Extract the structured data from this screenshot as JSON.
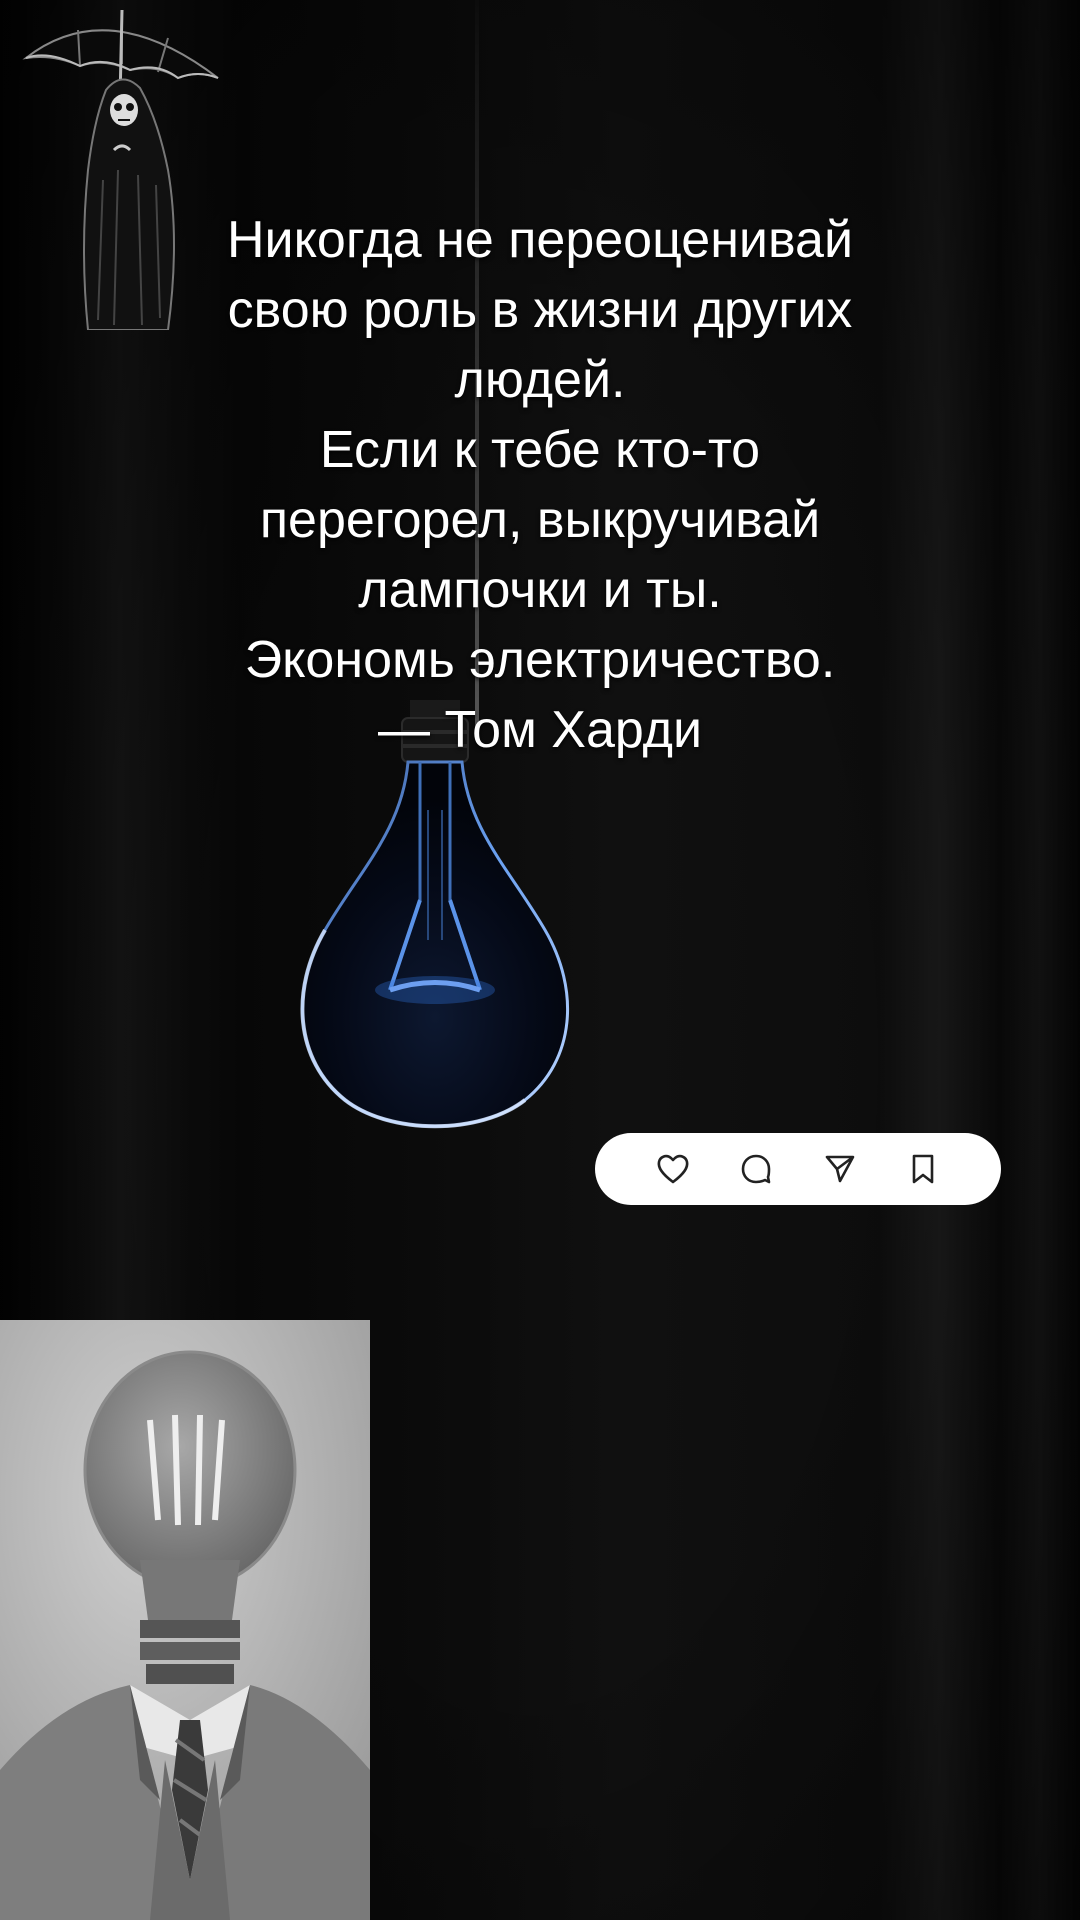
{
  "quote": {
    "lines": [
      "Никогда не переоценивай",
      "свою роль в жизни других",
      "людей.",
      "Если к тебе кто-то",
      "перегорел, выкручивай",
      "лампочки и ты.",
      "Экономь электричество.",
      "— Том Харди"
    ]
  },
  "actions": {
    "items": [
      {
        "icon": "heart-icon"
      },
      {
        "icon": "comment-icon"
      },
      {
        "icon": "send-icon"
      },
      {
        "icon": "bookmark-icon"
      }
    ]
  },
  "colors": {
    "text": "#ffffff",
    "bulb_glow": "#2e6fd6",
    "action_bar": "#ffffff"
  }
}
